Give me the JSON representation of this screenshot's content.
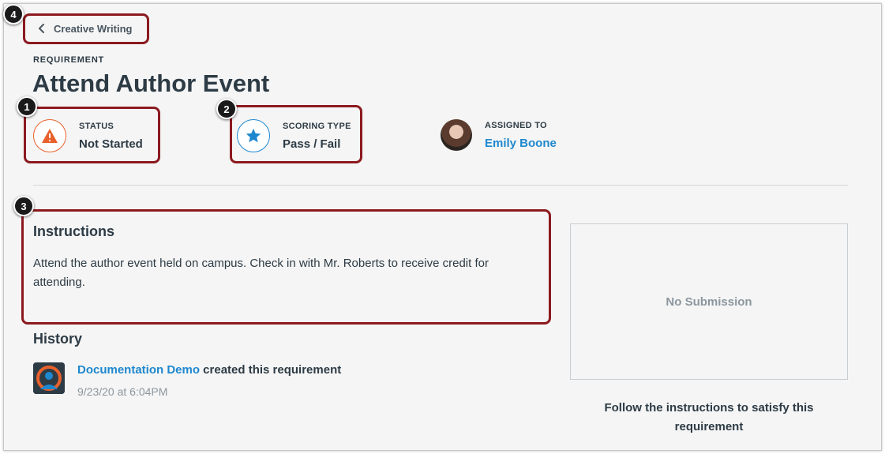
{
  "nav": {
    "back_label": "Creative Writing"
  },
  "header": {
    "section_label": "REQUIREMENT",
    "title": "Attend Author Event"
  },
  "meta": {
    "status": {
      "label": "STATUS",
      "value": "Not Started",
      "icon": "warning-icon",
      "color": "#e8612c"
    },
    "scoring": {
      "label": "SCORING TYPE",
      "value": "Pass / Fail",
      "icon": "star-icon",
      "color": "#1e88cf"
    },
    "assigned": {
      "label": "ASSIGNED TO",
      "value": "Emily Boone",
      "icon": "avatar"
    }
  },
  "instructions": {
    "title": "Instructions",
    "body": "Attend the author event held on campus. Check in with Mr. Roberts to receive credit for attending."
  },
  "history": {
    "title": "History",
    "entries": [
      {
        "actor": "Documentation Demo",
        "action": " created this requirement",
        "timestamp": "9/23/20 at 6:04PM"
      }
    ]
  },
  "submission": {
    "empty_label": "No Submission",
    "hint": "Follow the instructions to satisfy this requirement"
  },
  "annotations": [
    "1",
    "2",
    "3",
    "4"
  ],
  "colors": {
    "accent": "#1e88cf",
    "highlight": "#8b1a1f",
    "warning": "#e8612c"
  }
}
